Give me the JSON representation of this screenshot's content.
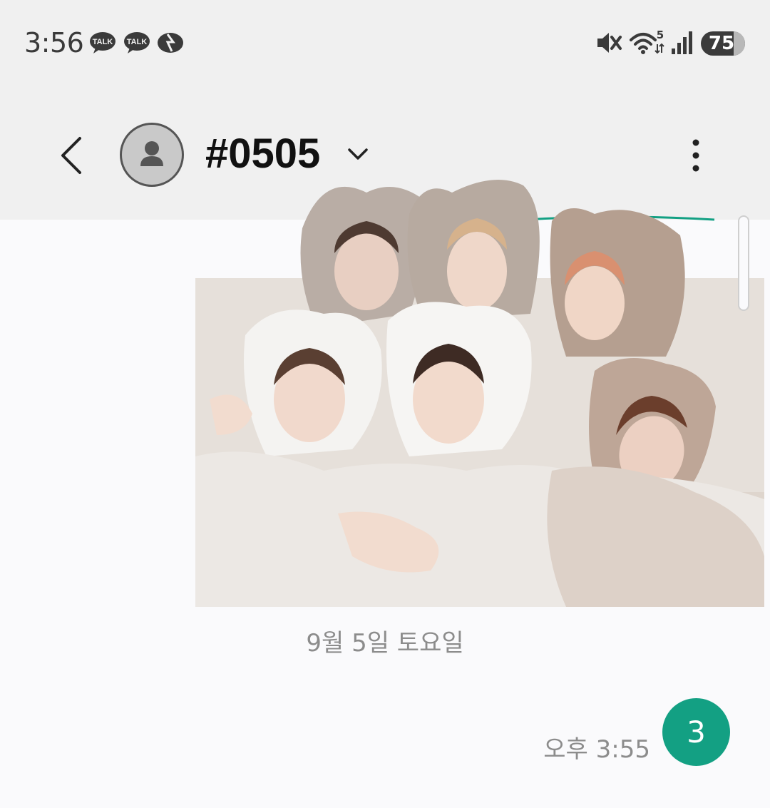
{
  "status_bar": {
    "time": "3:56",
    "notifications": [
      {
        "icon": "kakaotalk-icon",
        "text": "TALK"
      },
      {
        "icon": "kakaotalk-icon",
        "text": "TALK"
      },
      {
        "icon": "kakao-story-icon"
      }
    ],
    "battery_percent": "75",
    "wifi_label": "5"
  },
  "header": {
    "contact_name": "#0505",
    "avatar_icon": "person-icon"
  },
  "conversation": {
    "image_description": "Group photo of six people in fluffy animal-ear hoods",
    "date_divider": "9월 5일 토요일",
    "message_time": "오후 3:55",
    "message_badge": "3"
  },
  "colors": {
    "accent": "#13a083",
    "header_bg": "#f0f0f0",
    "body_bg": "#fafafc"
  }
}
